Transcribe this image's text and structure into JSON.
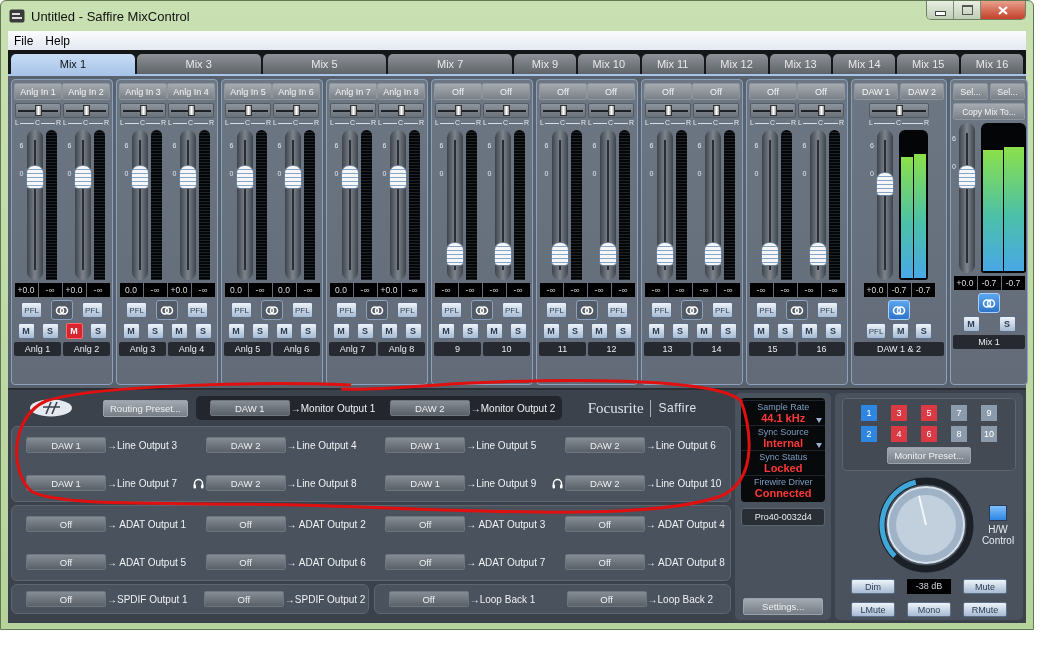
{
  "window": {
    "title": "Untitled - Saffire MixControl"
  },
  "menu": [
    "File",
    "Help"
  ],
  "tabs": [
    {
      "label": "Mix 1",
      "selected": true
    },
    {
      "label": "Mix 3",
      "selected": false
    },
    {
      "label": "Mix 5",
      "selected": false
    },
    {
      "label": "Mix 7",
      "selected": false
    },
    {
      "label": "Mix 9",
      "selected": false
    },
    {
      "label": "Mix 10",
      "selected": false
    },
    {
      "label": "Mix 11",
      "selected": false
    },
    {
      "label": "Mix 12",
      "selected": false
    },
    {
      "label": "Mix 13",
      "selected": false
    },
    {
      "label": "Mix 14",
      "selected": false
    },
    {
      "label": "Mix 15",
      "selected": false
    },
    {
      "label": "Mix 16",
      "selected": false
    }
  ],
  "channels": [
    {
      "source": "Anlg In 1",
      "pan": {
        "level": 0.5
      },
      "pan_scale": [
        "L",
        "C",
        "R"
      ],
      "fader_scale": [
        "6",
        "0"
      ],
      "fader": {
        "level": 0.72
      },
      "gain": "+0.0",
      "peak": "-∞",
      "pfl": "PFL",
      "mute": "M",
      "solo": "S",
      "muted": false,
      "name": "Anlg 1"
    },
    {
      "source": "Anlg In 2",
      "pan": {
        "level": 0.5
      },
      "pan_scale": [
        "L",
        "C",
        "R"
      ],
      "fader_scale": [
        "6",
        "0"
      ],
      "fader": {
        "level": 0.72
      },
      "gain": "+0.0",
      "peak": "-∞",
      "pfl": "PFL",
      "mute": "M",
      "solo": "S",
      "muted": true,
      "name": "Anlg 2"
    },
    {
      "source": "Anlg In 3",
      "pan": {
        "level": 0.5
      },
      "pan_scale": [
        "L",
        "C",
        "R"
      ],
      "fader_scale": [
        "6",
        "0"
      ],
      "fader": {
        "level": 0.72
      },
      "gain": "0.0",
      "peak": "-∞",
      "pfl": "PFL",
      "mute": "M",
      "solo": "S",
      "muted": false,
      "name": "Anlg 3"
    },
    {
      "source": "Anlg In 4",
      "pan": {
        "level": 0.5
      },
      "pan_scale": [
        "L",
        "C",
        "R"
      ],
      "fader_scale": [
        "6",
        "0"
      ],
      "fader": {
        "level": 0.72
      },
      "gain": "+0.0",
      "peak": "-∞",
      "pfl": "PFL",
      "mute": "M",
      "solo": "S",
      "muted": false,
      "name": "Anlg 4"
    },
    {
      "source": "Anlg In 5",
      "pan": {
        "level": 0.5
      },
      "pan_scale": [
        "L",
        "C",
        "R"
      ],
      "fader_scale": [
        "6",
        "0"
      ],
      "fader": {
        "level": 0.72
      },
      "gain": "0.0",
      "peak": "-∞",
      "pfl": "PFL",
      "mute": "M",
      "solo": "S",
      "muted": false,
      "name": "Anlg 5"
    },
    {
      "source": "Anlg In 6",
      "pan": {
        "level": 0.5
      },
      "pan_scale": [
        "L",
        "C",
        "R"
      ],
      "fader_scale": [
        "6",
        "0"
      ],
      "fader": {
        "level": 0.72
      },
      "gain": "0.0",
      "peak": "-∞",
      "pfl": "PFL",
      "mute": "M",
      "solo": "S",
      "muted": false,
      "name": "Anlg 6"
    },
    {
      "source": "Anlg In 7",
      "pan": {
        "level": 0.5
      },
      "pan_scale": [
        "L",
        "C",
        "R"
      ],
      "fader_scale": [
        "6",
        "0"
      ],
      "fader": {
        "level": 0.72
      },
      "gain": "0.0",
      "peak": "-∞",
      "pfl": "PFL",
      "mute": "M",
      "solo": "S",
      "muted": false,
      "name": "Anlg 7"
    },
    {
      "source": "Anlg In 8",
      "pan": {
        "level": 0.5
      },
      "pan_scale": [
        "L",
        "C",
        "R"
      ],
      "fader_scale": [
        "6",
        "0"
      ],
      "fader": {
        "level": 0.72
      },
      "gain": "+0.0",
      "peak": "-∞",
      "pfl": "PFL",
      "mute": "M",
      "solo": "S",
      "muted": false,
      "name": "Anlg 8"
    },
    {
      "source": "Off",
      "pan": {
        "level": 0.5
      },
      "pan_scale": [
        "L",
        "C",
        "R"
      ],
      "fader_scale": [
        "6",
        "0"
      ],
      "fader": {
        "level": 0.1
      },
      "gain": "-∞",
      "peak": "-∞",
      "pfl": "PFL",
      "mute": "M",
      "solo": "S",
      "muted": false,
      "name": "9"
    },
    {
      "source": "Off",
      "pan": {
        "level": 0.5
      },
      "pan_scale": [
        "L",
        "C",
        "R"
      ],
      "fader_scale": [
        "6",
        "0"
      ],
      "fader": {
        "level": 0.1
      },
      "gain": "-∞",
      "peak": "-∞",
      "pfl": "PFL",
      "mute": "M",
      "solo": "S",
      "muted": false,
      "name": "10"
    },
    {
      "source": "Off",
      "pan": {
        "level": 0.5
      },
      "pan_scale": [
        "L",
        "C",
        "R"
      ],
      "fader_scale": [
        "6",
        "0"
      ],
      "fader": {
        "level": 0.1
      },
      "gain": "-∞",
      "peak": "-∞",
      "pfl": "PFL",
      "mute": "M",
      "solo": "S",
      "muted": false,
      "name": "11"
    },
    {
      "source": "Off",
      "pan": {
        "level": 0.5
      },
      "pan_scale": [
        "L",
        "C",
        "R"
      ],
      "fader_scale": [
        "6",
        "0"
      ],
      "fader": {
        "level": 0.1
      },
      "gain": "-∞",
      "peak": "-∞",
      "pfl": "PFL",
      "mute": "M",
      "solo": "S",
      "muted": false,
      "name": "12"
    },
    {
      "source": "Off",
      "pan": {
        "level": 0.5
      },
      "pan_scale": [
        "L",
        "C",
        "R"
      ],
      "fader_scale": [
        "6",
        "0"
      ],
      "fader": {
        "level": 0.1
      },
      "gain": "-∞",
      "peak": "-∞",
      "pfl": "PFL",
      "mute": "M",
      "solo": "S",
      "muted": false,
      "name": "13"
    },
    {
      "source": "Off",
      "pan": {
        "level": 0.5
      },
      "pan_scale": [
        "L",
        "C",
        "R"
      ],
      "fader_scale": [
        "6",
        "0"
      ],
      "fader": {
        "level": 0.1
      },
      "gain": "-∞",
      "peak": "-∞",
      "pfl": "PFL",
      "mute": "M",
      "solo": "S",
      "muted": false,
      "name": "14"
    },
    {
      "source": "Off",
      "pan": {
        "level": 0.5
      },
      "pan_scale": [
        "L",
        "C",
        "R"
      ],
      "fader_scale": [
        "6",
        "0"
      ],
      "fader": {
        "level": 0.1
      },
      "gain": "-∞",
      "peak": "-∞",
      "pfl": "PFL",
      "mute": "M",
      "solo": "S",
      "muted": false,
      "name": "15"
    },
    {
      "source": "Off",
      "pan": {
        "level": 0.5
      },
      "pan_scale": [
        "L",
        "C",
        "R"
      ],
      "fader_scale": [
        "6",
        "0"
      ],
      "fader": {
        "level": 0.1
      },
      "gain": "-∞",
      "peak": "-∞",
      "pfl": "PFL",
      "mute": "M",
      "solo": "S",
      "muted": false,
      "name": "16"
    }
  ],
  "pairs": [
    {
      "linked": false
    },
    {
      "linked": false
    },
    {
      "linked": false
    },
    {
      "linked": false
    },
    {
      "linked": false
    },
    {
      "linked": false
    },
    {
      "linked": false
    },
    {
      "linked": false
    }
  ],
  "daw_strip": {
    "sources": [
      "DAW 1",
      "DAW 2"
    ],
    "pan": {
      "level": 0.5
    },
    "pan_scale": [
      "L",
      "C",
      "R"
    ],
    "fader_scale": [
      "6",
      "0"
    ],
    "fader": {
      "level": 0.66
    },
    "meters": [
      {
        "level": 0.88
      },
      {
        "level": 0.9
      }
    ],
    "readouts": [
      "+0.0",
      "-0.7",
      "-0.7"
    ],
    "linked": true,
    "pfl": "PFL",
    "mute": "M",
    "solo": "S",
    "name": "DAW 1 & 2"
  },
  "master_strip": {
    "sources": [
      "Sel...",
      "Sel..."
    ],
    "copy_button": "Copy Mix To...",
    "fader_scale": [
      "6",
      "0"
    ],
    "fader": {
      "level": 0.66
    },
    "meters": [
      {
        "level": 0.88
      },
      {
        "level": 0.9
      }
    ],
    "readouts": [
      "+0.0",
      "-0.7",
      "-0.7"
    ],
    "linked": true,
    "mute": "M",
    "solo": "S",
    "name": "Mix 1"
  },
  "routing": {
    "preset_button": "Routing Preset...",
    "brand": "Focusrite",
    "product": "Saffire",
    "monitor_outputs": [
      {
        "source": "DAW 1",
        "output": "→Monitor Output 1"
      },
      {
        "source": "DAW 2",
        "output": "→Monitor Output 2"
      }
    ],
    "line_outputs": [
      {
        "source": "DAW 1",
        "output": "→Line Output 3",
        "headphone": false
      },
      {
        "source": "DAW 2",
        "output": "→Line Output 4",
        "headphone": false
      },
      {
        "source": "DAW 1",
        "output": "→Line Output 5",
        "headphone": false
      },
      {
        "source": "DAW 2",
        "output": "→Line Output 6",
        "headphone": false
      },
      {
        "source": "DAW 1",
        "output": "→Line Output 7",
        "headphone": false
      },
      {
        "source": "DAW 2",
        "output": "→Line Output 8",
        "headphone": true
      },
      {
        "source": "DAW 1",
        "output": "→Line Output 9",
        "headphone": false
      },
      {
        "source": "DAW 2",
        "output": "→Line Output 10",
        "headphone": true
      }
    ],
    "adat_outputs": [
      {
        "source": "Off",
        "output": "→ ADAT Output 1"
      },
      {
        "source": "Off",
        "output": "→ ADAT Output 2"
      },
      {
        "source": "Off",
        "output": "→ ADAT Output 3"
      },
      {
        "source": "Off",
        "output": "→ ADAT Output 4"
      },
      {
        "source": "Off",
        "output": "→ ADAT Output 5"
      },
      {
        "source": "Off",
        "output": "→ ADAT Output 6"
      },
      {
        "source": "Off",
        "output": "→ ADAT Output 7"
      },
      {
        "source": "Off",
        "output": "→ ADAT Output 8"
      }
    ],
    "spdif_outputs": [
      {
        "source": "Off",
        "output": "→SPDIF Output 1"
      },
      {
        "source": "Off",
        "output": "→SPDIF Output 2"
      }
    ],
    "loopback_outputs": [
      {
        "source": "Off",
        "output": "→Loop Back 1"
      },
      {
        "source": "Off",
        "output": "→Loop Back 2"
      }
    ]
  },
  "status": {
    "fields": [
      {
        "label": "Sample Rate",
        "value": "44.1 kHz",
        "dropdown": true
      },
      {
        "label": "Sync Source",
        "value": "Internal",
        "dropdown": true
      },
      {
        "label": "Sync Status",
        "value": "Locked",
        "dropdown": false
      },
      {
        "label": "Firewire Driver",
        "value": "Connected",
        "dropdown": false
      }
    ],
    "device": "Pro40-0032d4",
    "settings_button": "Settings..."
  },
  "monitor": {
    "speakers": [
      {
        "label": "1",
        "color": "#2e86e0"
      },
      {
        "label": "3",
        "color": "#d93a44"
      },
      {
        "label": "5",
        "color": "#d93a44"
      },
      {
        "label": "7",
        "color": "#8c9bab"
      },
      {
        "label": "9",
        "color": "#8c9bab"
      },
      {
        "label": "2",
        "color": "#2e86e0"
      },
      {
        "label": "4",
        "color": "#d93a44"
      },
      {
        "label": "6",
        "color": "#d93a44"
      },
      {
        "label": "8",
        "color": "#8c9bab"
      },
      {
        "label": "10",
        "color": "#8c9bab"
      }
    ],
    "preset_button": "Monitor Preset...",
    "volume": {
      "level": 0.45
    },
    "readout": "-38 dB",
    "hw_control": {
      "label": "H/W Control",
      "on": true
    },
    "buttons": [
      "Dim",
      "Mute",
      "LMute",
      "Mono",
      "RMute"
    ]
  }
}
